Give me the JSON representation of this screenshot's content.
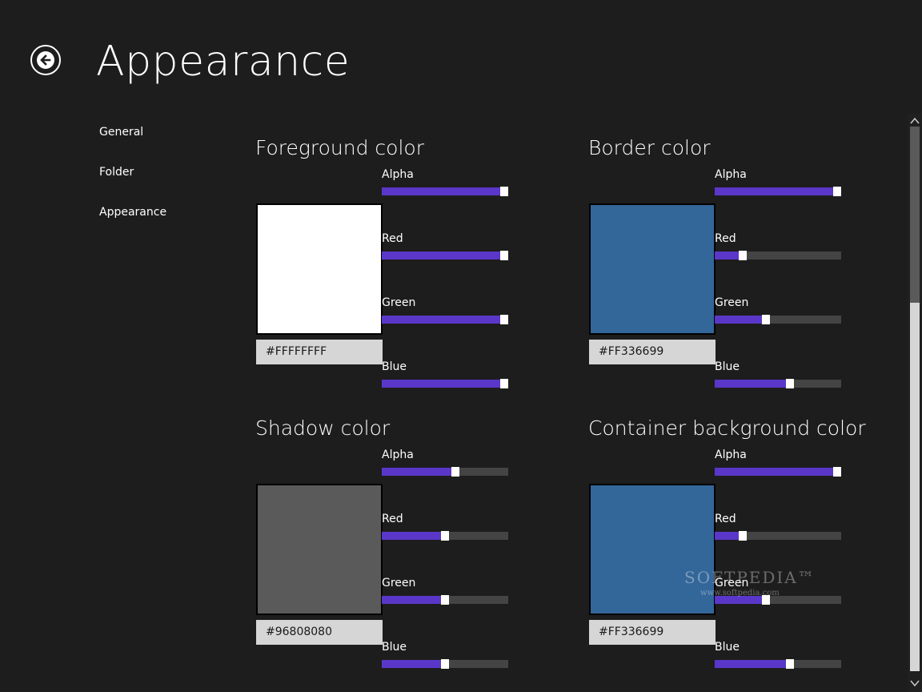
{
  "header": {
    "title": "Appearance",
    "back_icon": "back-arrow-icon"
  },
  "nav": {
    "items": [
      {
        "label": "General"
      },
      {
        "label": "Folder"
      },
      {
        "label": "Appearance"
      }
    ]
  },
  "colors": {
    "slider_fill": "#5a37c8",
    "slider_track": "#444444",
    "background": "#1d1d1d"
  },
  "sections": [
    {
      "title": "Foreground color",
      "hex": "#FFFFFFFF",
      "swatch": "#ffffff",
      "channels": [
        {
          "label": "Alpha",
          "value": 255
        },
        {
          "label": "Red",
          "value": 255
        },
        {
          "label": "Green",
          "value": 255
        },
        {
          "label": "Blue",
          "value": 255
        }
      ]
    },
    {
      "title": "Border color",
      "hex": "#FF336699",
      "swatch": "#336699",
      "channels": [
        {
          "label": "Alpha",
          "value": 255
        },
        {
          "label": "Red",
          "value": 51
        },
        {
          "label": "Green",
          "value": 102
        },
        {
          "label": "Blue",
          "value": 153
        }
      ]
    },
    {
      "title": "Shadow color",
      "hex": "#96808080",
      "swatch": "#5a5a5a",
      "channels": [
        {
          "label": "Alpha",
          "value": 150
        },
        {
          "label": "Red",
          "value": 128
        },
        {
          "label": "Green",
          "value": 128
        },
        {
          "label": "Blue",
          "value": 128
        }
      ]
    },
    {
      "title": "Container background color",
      "hex": "#FF336699",
      "swatch": "#336699",
      "channels": [
        {
          "label": "Alpha",
          "value": 255
        },
        {
          "label": "Red",
          "value": 51
        },
        {
          "label": "Green",
          "value": 102
        },
        {
          "label": "Blue",
          "value": 153
        }
      ]
    }
  ],
  "watermark": {
    "brand": "SOFTPEDIA™",
    "url": "www.softpedia.com"
  }
}
